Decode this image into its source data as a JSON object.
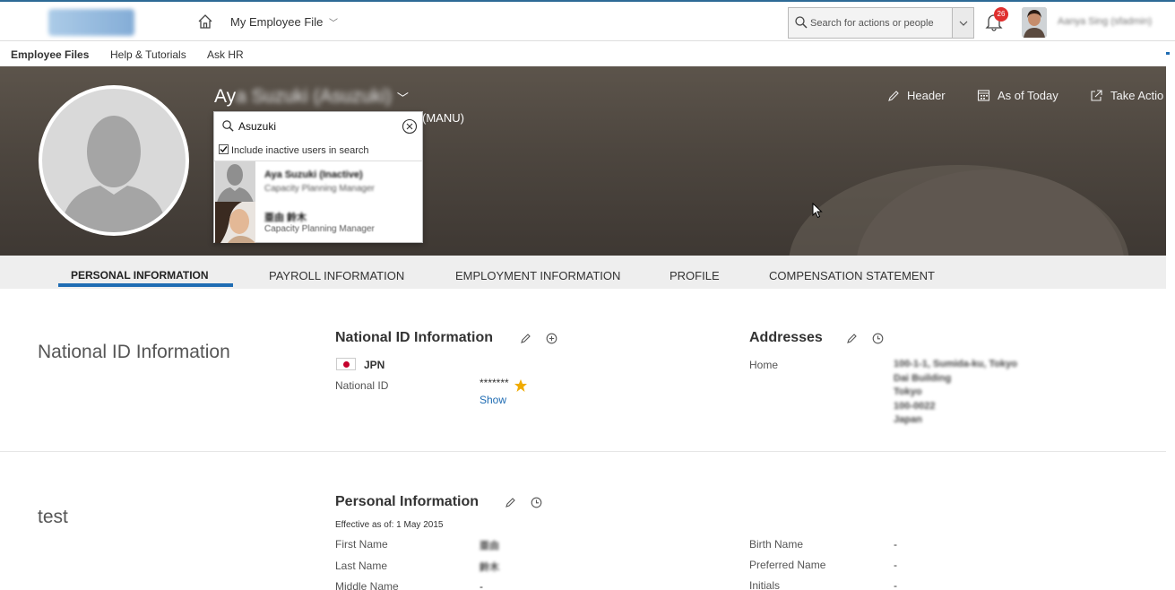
{
  "topbar": {
    "nav_title": "My Employee File",
    "search_placeholder": "Search for actions or people",
    "notification_count": "26",
    "user_name": "Aanya Sing (sfadmin)"
  },
  "subnav": {
    "items": [
      "Employee Files",
      "Help & Tutorials",
      "Ask HR"
    ]
  },
  "header": {
    "name_initial": "Ay",
    "name_rest": "a Suzuki (Asuzuki)",
    "subtitle": "(MANU)",
    "actions": [
      "Header",
      "As of Today",
      "Take Actio"
    ]
  },
  "search_dropdown": {
    "query": "Asuzuki",
    "include_inactive_label": "Include inactive users in search",
    "include_inactive_checked": true,
    "results": [
      {
        "name": "Aya Suzuki (Inactive)",
        "role": "Capacity Planning Manager"
      },
      {
        "name": "亜由 鈴木",
        "role": "Capacity Planning Manager"
      }
    ]
  },
  "tabs": [
    "PERSONAL INFORMATION",
    "PAYROLL INFORMATION",
    "EMPLOYMENT INFORMATION",
    "PROFILE",
    "COMPENSATION STATEMENT"
  ],
  "national_id_section": {
    "section_title": "National ID Information",
    "block_title": "National ID Information",
    "country": "JPN",
    "id_label": "National ID",
    "id_value": "*******",
    "show_link": "Show"
  },
  "addresses": {
    "title": "Addresses",
    "type_label": "Home",
    "lines": [
      "100-1-1, Sumida-ku, Tokyo",
      "Dai Building",
      "Tokyo",
      "100-0022",
      "Japan"
    ]
  },
  "test_section": {
    "section_title": "test"
  },
  "personal_info": {
    "title": "Personal Information",
    "effective": "Effective as of: 1 May 2015",
    "fields_left": [
      {
        "label": "First Name",
        "value": "亜由"
      },
      {
        "label": "Last Name",
        "value": "鈴木"
      },
      {
        "label": "Middle Name",
        "value": "-"
      }
    ],
    "fields_right": [
      {
        "label": "Birth Name",
        "value": "-"
      },
      {
        "label": "Preferred Name",
        "value": "-"
      },
      {
        "label": "Initials",
        "value": "-"
      }
    ]
  }
}
